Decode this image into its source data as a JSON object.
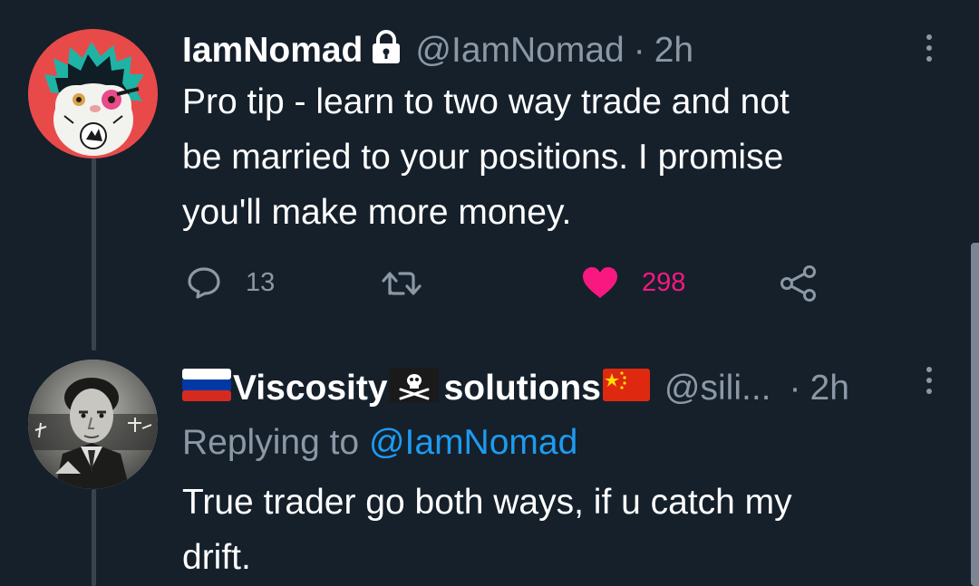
{
  "tweet": {
    "author_name": "IamNomad",
    "handle": "@IamNomad",
    "separator": "·",
    "time": "2h",
    "text_lines": [
      "Pro tip - learn to two way trade and not",
      "be married to your positions. I promise",
      "you'll make more money."
    ],
    "actions": {
      "replies": "13",
      "retweets": "",
      "likes": "298"
    },
    "avatar_icon": "cartoon-avatar-icon",
    "protected_icon": "lock-icon"
  },
  "reply": {
    "author_name_part1": "Viscosity",
    "author_name_part2": "solutions",
    "handle": "@sili...",
    "separator": "·",
    "time": "2h",
    "replying_to_prefix": "Replying to ",
    "replying_to_handle": "@IamNomad",
    "text_lines": [
      "True trader go both ways, if u catch my",
      "drift."
    ],
    "avatar_icon": "photo-avatar-icon",
    "flag_icons": [
      "russia-flag-icon",
      "skull-crossbones-icon",
      "china-flag-icon"
    ]
  },
  "colors": {
    "background": "#15202b",
    "secondary_text": "#8b98a5",
    "like_pink": "#f91880",
    "link_blue": "#1d9bf0"
  }
}
